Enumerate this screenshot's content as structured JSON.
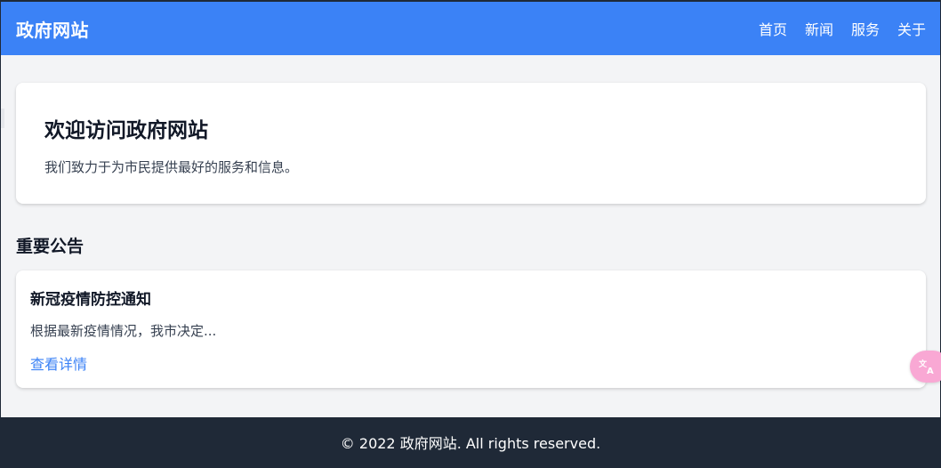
{
  "header": {
    "brand": "政府网站",
    "nav": [
      "首页",
      "新闻",
      "服务",
      "关于"
    ]
  },
  "hero": {
    "title": "欢迎访问政府网站",
    "text": "我们致力于为市民提供最好的服务和信息。"
  },
  "announcements": {
    "section_title": "重要公告",
    "items": [
      {
        "title": "新冠疫情防控通知",
        "summary": "根据最新疫情情况，我市决定...",
        "link_label": "查看详情"
      }
    ]
  },
  "footer": {
    "text": "© 2022 政府网站. All rights reserved."
  },
  "widgets": {
    "translate_icon": "translate-icon"
  },
  "colors": {
    "primary": "#3b82f6",
    "footer_bg": "#1f2937",
    "page_bg": "#f3f4f6",
    "translate_bg": "#f9a8d4"
  }
}
